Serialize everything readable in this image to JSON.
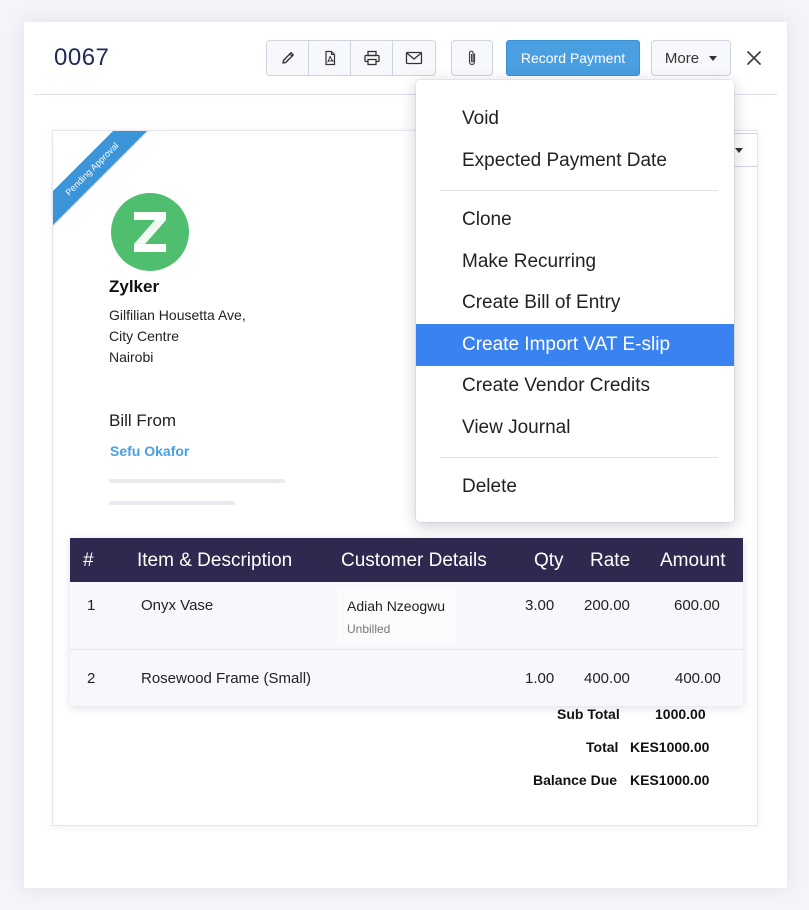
{
  "header": {
    "bill_number": "0067",
    "record_payment_label": "Record Payment",
    "more_label": "More"
  },
  "document": {
    "ribbon_label": "Pending Approval",
    "company": {
      "name": "Zylker",
      "address_lines": [
        "Gilfilian Housetta Ave,",
        "City Centre",
        "Nairobi"
      ]
    },
    "bill_from_label": "Bill From",
    "vendor_name": "Sefu Okafor"
  },
  "items_table": {
    "columns": [
      "#",
      "Item & Description",
      "Customer Details",
      "Qty",
      "Rate",
      "Amount"
    ],
    "rows": [
      {
        "num": "1",
        "item": "Onyx Vase",
        "customer": "Adiah Nzeogwu",
        "customer_status": "Unbilled",
        "qty": "3.00",
        "rate": "200.00",
        "amount": "600.00"
      },
      {
        "num": "2",
        "item": "Rosewood Frame (Small)",
        "customer": "",
        "customer_status": "",
        "qty": "1.00",
        "rate": "400.00",
        "amount": "400.00"
      }
    ]
  },
  "totals": {
    "sub_total_label": "Sub Total",
    "sub_total_value": "1000.00",
    "total_label": "Total",
    "total_value": "KES1000.00",
    "balance_due_label": "Balance Due",
    "balance_due_value": "KES1000.00"
  },
  "more_menu": {
    "items": [
      "Void",
      "Expected Payment Date",
      "Clone",
      "Make Recurring",
      "Create Bill of Entry",
      "Create Import VAT E-slip",
      "Create Vendor Credits",
      "View Journal",
      "Delete"
    ],
    "highlighted": "Create Import VAT E-slip"
  },
  "icons": {
    "toolbar": [
      "pencil-icon",
      "pdf-icon",
      "printer-icon",
      "email-icon"
    ],
    "attach": "paperclip-icon",
    "close": "close-icon",
    "logo": "zylker-z-logo"
  },
  "colors": {
    "primary_button": "#4a9fe1",
    "table_header": "#2e2a4f",
    "menu_highlight": "#3b82f1",
    "logo_green": "#4fbf6f",
    "ribbon": "#3d95d9",
    "link": "#4a9fe1"
  }
}
